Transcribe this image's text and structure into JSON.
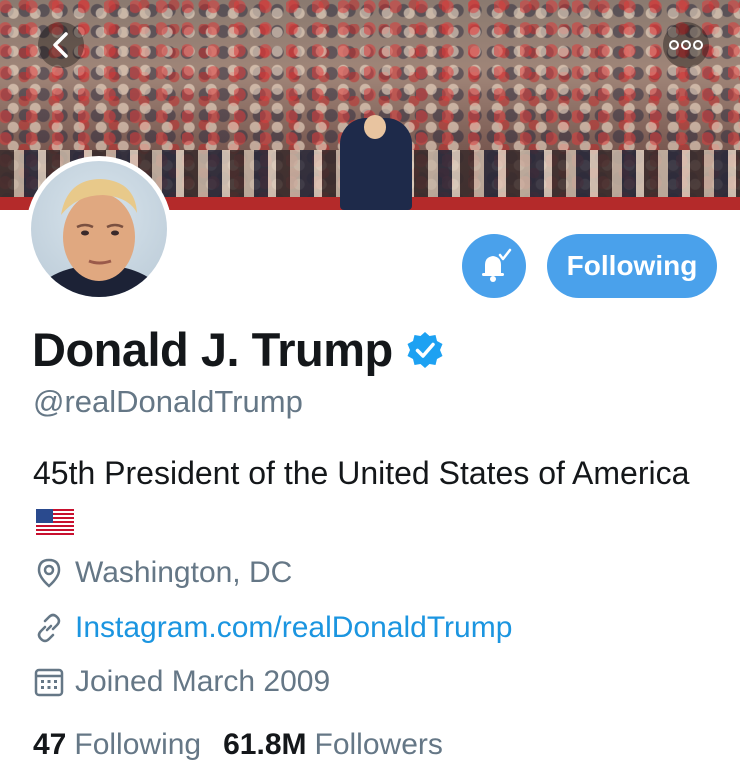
{
  "profile": {
    "name": "Donald J. Trump",
    "handle": "@realDonaldTrump",
    "bio": "45th President of the United States of America",
    "location": "Washington, DC",
    "website": "Instagram.com/realDonaldTrump",
    "joined": "Joined March 2009"
  },
  "actions": {
    "following_label": "Following"
  },
  "stats": {
    "following_count": "47",
    "following_label": "Following",
    "followers_count": "61.8M",
    "followers_label": "Followers"
  },
  "icons": {
    "back": "chevron-left-icon",
    "more": "more-dots-icon",
    "bell": "bell-check-icon",
    "verified": "verified-badge-icon",
    "location": "location-pin-icon",
    "link": "link-icon",
    "calendar": "calendar-icon"
  },
  "colors": {
    "accent": "#4aa1eb",
    "link": "#1b95e0",
    "muted": "#657786",
    "text": "#14171a"
  }
}
